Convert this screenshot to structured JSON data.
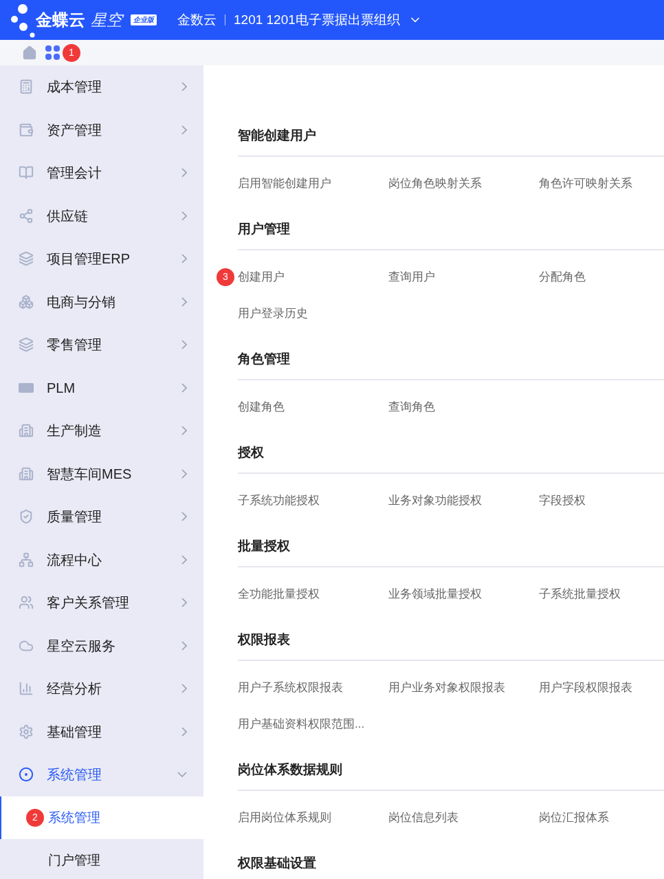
{
  "header": {
    "logo": "金蝶云",
    "logo_sub": "星空",
    "edition": "企业版",
    "tenant": "金数云",
    "org": "1201 1201电子票据出票组织"
  },
  "toolbar": {
    "apps_badge": "1"
  },
  "sidebar": {
    "items": [
      {
        "label": "成本管理",
        "expanded": false
      },
      {
        "label": "资产管理",
        "expanded": false
      },
      {
        "label": "管理会计",
        "expanded": false
      },
      {
        "label": "供应链",
        "expanded": false
      },
      {
        "label": "项目管理ERP",
        "expanded": false
      },
      {
        "label": "电商与分销",
        "expanded": false
      },
      {
        "label": "零售管理",
        "expanded": false
      },
      {
        "label": "PLM",
        "expanded": false
      },
      {
        "label": "生产制造",
        "expanded": false
      },
      {
        "label": "智慧车间MES",
        "expanded": false
      },
      {
        "label": "质量管理",
        "expanded": false
      },
      {
        "label": "流程中心",
        "expanded": false
      },
      {
        "label": "客户关系管理",
        "expanded": false
      },
      {
        "label": "星空云服务",
        "expanded": false
      },
      {
        "label": "经营分析",
        "expanded": false
      },
      {
        "label": "基础管理",
        "expanded": false
      },
      {
        "label": "系统管理",
        "expanded": true,
        "children": [
          {
            "label": "系统管理",
            "selected": true,
            "badge": "2"
          },
          {
            "label": "门户管理",
            "selected": false
          }
        ]
      }
    ]
  },
  "sections": [
    {
      "title": "智能创建用户",
      "links": [
        {
          "label": "启用智能创建用户"
        },
        {
          "label": "岗位角色映射关系"
        },
        {
          "label": "角色许可映射关系"
        }
      ]
    },
    {
      "title": "用户管理",
      "links": [
        {
          "label": "创建用户",
          "badge": "3"
        },
        {
          "label": "查询用户"
        },
        {
          "label": "分配角色"
        },
        {
          "label": "用户登录历史"
        }
      ]
    },
    {
      "title": "角色管理",
      "links": [
        {
          "label": "创建角色"
        },
        {
          "label": "查询角色"
        }
      ]
    },
    {
      "title": "授权",
      "links": [
        {
          "label": "子系统功能授权"
        },
        {
          "label": "业务对象功能授权"
        },
        {
          "label": "字段授权"
        }
      ]
    },
    {
      "title": "批量授权",
      "links": [
        {
          "label": "全功能批量授权"
        },
        {
          "label": "业务领域批量授权"
        },
        {
          "label": "子系统批量授权"
        }
      ]
    },
    {
      "title": "权限报表",
      "links": [
        {
          "label": "用户子系统权限报表"
        },
        {
          "label": "用户业务对象权限报表"
        },
        {
          "label": "用户字段权限报表"
        },
        {
          "label": "用户基础资料权限范围..."
        }
      ]
    },
    {
      "title": "岗位体系数据规则",
      "links": [
        {
          "label": "启用岗位体系规则"
        },
        {
          "label": "岗位信息列表"
        },
        {
          "label": "岗位汇报体系"
        }
      ]
    },
    {
      "title": "权限基础设置"
    }
  ]
}
